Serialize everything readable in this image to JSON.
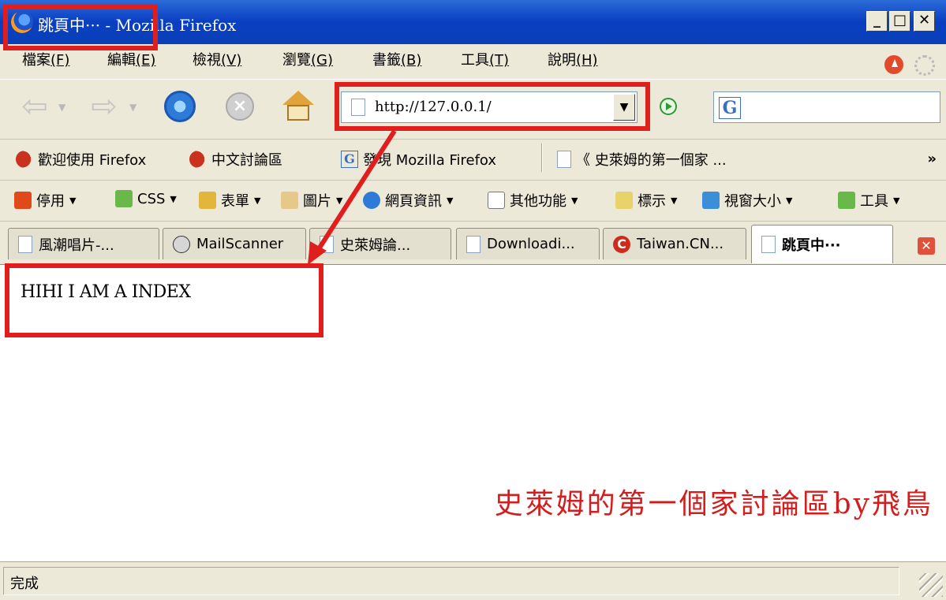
{
  "window": {
    "title_full": "跳頁中··· - Mozilla Firefox",
    "controls": {
      "minimize": "_",
      "maximize": "□",
      "close": "✕"
    }
  },
  "menu": [
    {
      "label": "檔案",
      "hotkey": "(F)"
    },
    {
      "label": "編輯",
      "hotkey": "(E)"
    },
    {
      "label": "檢視",
      "hotkey": "(V)"
    },
    {
      "label": "瀏覽",
      "hotkey": "(G)"
    },
    {
      "label": "書籤",
      "hotkey": "(B)"
    },
    {
      "label": "工具",
      "hotkey": "(T)"
    },
    {
      "label": "說明",
      "hotkey": "(H)"
    }
  ],
  "nav": {
    "url": "http://127.0.0.1/",
    "search_engine_icon": "G"
  },
  "bookmarks": [
    {
      "icon": "firefox-red-icon",
      "label": "歡迎使用 Firefox"
    },
    {
      "icon": "firefox-red-icon",
      "label": "中文討論區"
    },
    {
      "icon": "google-icon",
      "label": "發現 Mozilla Firefox"
    },
    {
      "icon": "page-icon",
      "label": "《 史萊姆的第一個家 ..."
    }
  ],
  "bookmarks_overflow": "»",
  "devbar": [
    {
      "icon": "disable-icon",
      "label": "停用"
    },
    {
      "icon": "css-icon",
      "label": "CSS"
    },
    {
      "icon": "lock-icon",
      "label": "表單"
    },
    {
      "icon": "images-icon",
      "label": "圖片"
    },
    {
      "icon": "info-icon",
      "label": "網頁資訊"
    },
    {
      "icon": "misc-icon",
      "label": "其他功能"
    },
    {
      "icon": "outline-icon",
      "label": "標示"
    },
    {
      "icon": "resize-icon",
      "label": "視窗大小"
    },
    {
      "icon": "tools-icon",
      "label": "工具"
    }
  ],
  "tabs": [
    {
      "icon": "page",
      "label": "風潮唱片-..."
    },
    {
      "icon": "mail",
      "label": "MailScanner"
    },
    {
      "icon": "page",
      "label": "史萊姆論..."
    },
    {
      "icon": "page",
      "label": "Downloadi..."
    },
    {
      "icon": "c",
      "label": "Taiwan.CN..."
    },
    {
      "icon": "page",
      "label": "跳頁中···",
      "active": true
    }
  ],
  "content": {
    "text": "HIHI I AM A INDEX",
    "watermark": "史萊姆的第一個家討論區by飛鳥"
  },
  "status": {
    "text": "完成"
  },
  "colors": {
    "annotation": "#e01e1e",
    "titlebar": "#0a3fc2",
    "chrome": "#ece9d8"
  }
}
